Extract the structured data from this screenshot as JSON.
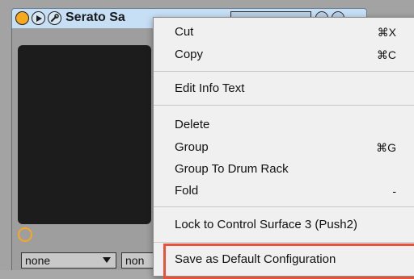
{
  "device": {
    "title": "Serato Sa",
    "selects": [
      {
        "value": "none"
      },
      {
        "value": "non"
      }
    ]
  },
  "menu": {
    "items": [
      {
        "label": "Cut",
        "shortcut": "⌘X"
      },
      {
        "label": "Copy",
        "shortcut": "⌘C"
      },
      {
        "label": "Edit Info Text",
        "shortcut": ""
      },
      {
        "label": "Delete",
        "shortcut": ""
      },
      {
        "label": "Group",
        "shortcut": "⌘G"
      },
      {
        "label": "Group To Drum Rack",
        "shortcut": ""
      },
      {
        "label": "Fold",
        "shortcut": "-"
      },
      {
        "label": "Lock to Control Surface 3 (Push2)",
        "shortcut": ""
      },
      {
        "label": "Save as Default Configuration",
        "shortcut": ""
      }
    ]
  },
  "colors": {
    "accent": "#f6a81e",
    "highlight_border": "#e8523a",
    "title_bar": "#c7dff5"
  }
}
